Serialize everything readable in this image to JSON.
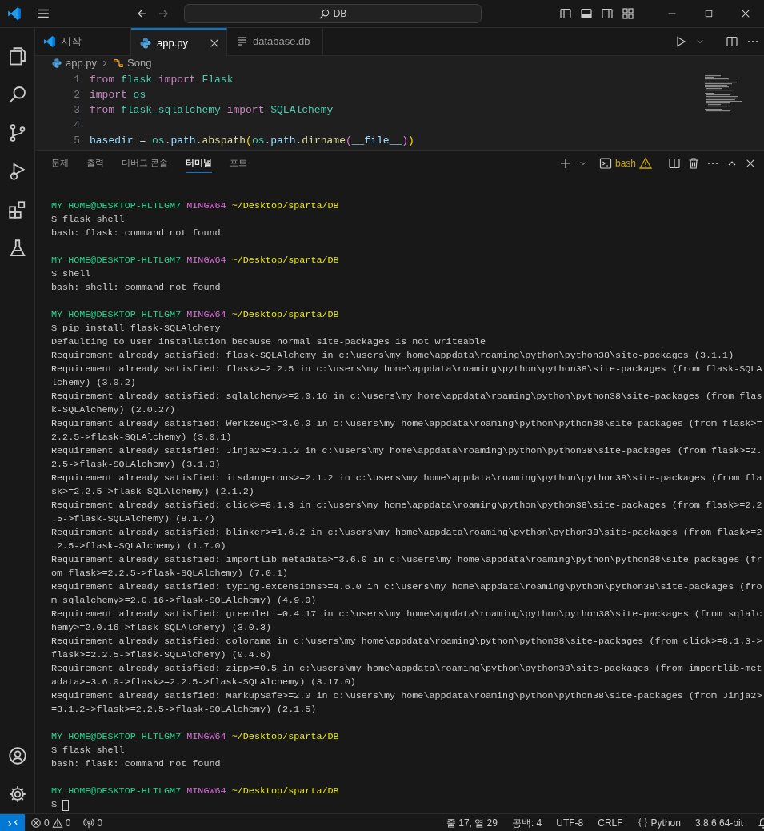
{
  "title_bar": {
    "search": "DB"
  },
  "tabs": [
    {
      "label": "시작",
      "kind": "welcome",
      "selected": false
    },
    {
      "label": "app.py",
      "kind": "python",
      "selected": true
    },
    {
      "label": "database.db",
      "kind": "file",
      "selected": false
    }
  ],
  "breadcrumbs": [
    {
      "label": "app.py",
      "kind": "python"
    },
    {
      "label": "Song",
      "kind": "symbol"
    }
  ],
  "editor": {
    "lines": [
      {
        "number": "1",
        "tokens": [
          {
            "text": "from ",
            "kind": "keyword"
          },
          {
            "text": "flask ",
            "kind": "module"
          },
          {
            "text": "import ",
            "kind": "keyword"
          },
          {
            "text": "Flask",
            "kind": "module"
          }
        ]
      },
      {
        "number": "2",
        "tokens": [
          {
            "text": "import ",
            "kind": "keyword"
          },
          {
            "text": "os",
            "kind": "module"
          }
        ]
      },
      {
        "number": "3",
        "tokens": [
          {
            "text": "from ",
            "kind": "keyword"
          },
          {
            "text": "flask_sqlalchemy ",
            "kind": "module"
          },
          {
            "text": "import ",
            "kind": "keyword"
          },
          {
            "text": "SQLAlchemy",
            "kind": "module"
          }
        ]
      },
      {
        "number": "4"
      },
      {
        "number": "5",
        "tokens": [
          {
            "text": "basedir",
            "kind": "variable"
          },
          {
            "text": " = ",
            "kind": "operator"
          },
          {
            "text": "os",
            "kind": "module"
          },
          {
            "text": ".",
            "kind": "operator"
          },
          {
            "text": "path",
            "kind": "variable"
          },
          {
            "text": ".",
            "kind": "operator"
          },
          {
            "text": "abspath",
            "kind": "function"
          },
          {
            "text": "(",
            "kind": "bracket1"
          },
          {
            "text": "os",
            "kind": "module"
          },
          {
            "text": ".",
            "kind": "operator"
          },
          {
            "text": "path",
            "kind": "variable"
          },
          {
            "text": ".",
            "kind": "operator"
          },
          {
            "text": "dirname",
            "kind": "function"
          },
          {
            "text": "(",
            "kind": "bracket2"
          },
          {
            "text": "__file__",
            "kind": "variable"
          },
          {
            "text": ")",
            "kind": "bracket2"
          },
          {
            "text": ")",
            "kind": "bracket1"
          }
        ]
      }
    ]
  },
  "panel": {
    "tabs": [
      {
        "label": "문제",
        "selected": false
      },
      {
        "label": "출력",
        "selected": false
      },
      {
        "label": "디버그 콘솔",
        "selected": false
      },
      {
        "label": "터미널",
        "selected": true
      },
      {
        "label": "포트",
        "selected": false
      }
    ],
    "terminal_name": "bash",
    "sessions": [
      {
        "user": "MY HOME@DESKTOP-HLTLGM7",
        "system": "MINGW64",
        "path": "~/Desktop/sparta/DB",
        "command": "$ flask shell",
        "cursor": false,
        "output": [
          "bash: flask: command not found"
        ]
      },
      {
        "user": "MY HOME@DESKTOP-HLTLGM7",
        "system": "MINGW64",
        "path": "~/Desktop/sparta/DB",
        "command": "$ shell",
        "cursor": false,
        "output": [
          "bash: shell: command not found"
        ]
      },
      {
        "user": "MY HOME@DESKTOP-HLTLGM7",
        "system": "MINGW64",
        "path": "~/Desktop/sparta/DB",
        "command": "$ pip install flask-SQLAlchemy",
        "cursor": false,
        "output": [
          "Defaulting to user installation because normal site-packages is not writeable",
          "Requirement already satisfied: flask-SQLAlchemy in c:\\users\\my home\\appdata\\roaming\\python\\python38\\site-packages (3.1.1)",
          "Requirement already satisfied: flask>=2.2.5 in c:\\users\\my home\\appdata\\roaming\\python\\python38\\site-packages (from flask-SQLA",
          "lchemy) (3.0.2)",
          "Requirement already satisfied: sqlalchemy>=2.0.16 in c:\\users\\my home\\appdata\\roaming\\python\\python38\\site-packages (from flas",
          "k-SQLAlchemy) (2.0.27)",
          "Requirement already satisfied: Werkzeug>=3.0.0 in c:\\users\\my home\\appdata\\roaming\\python\\python38\\site-packages (from flask>=",
          "2.2.5->flask-SQLAlchemy) (3.0.1)",
          "Requirement already satisfied: Jinja2>=3.1.2 in c:\\users\\my home\\appdata\\roaming\\python\\python38\\site-packages (from flask>=2.",
          "2.5->flask-SQLAlchemy) (3.1.3)",
          "Requirement already satisfied: itsdangerous>=2.1.2 in c:\\users\\my home\\appdata\\roaming\\python\\python38\\site-packages (from fla",
          "sk>=2.2.5->flask-SQLAlchemy) (2.1.2)",
          "Requirement already satisfied: click>=8.1.3 in c:\\users\\my home\\appdata\\roaming\\python\\python38\\site-packages (from flask>=2.2",
          ".5->flask-SQLAlchemy) (8.1.7)",
          "Requirement already satisfied: blinker>=1.6.2 in c:\\users\\my home\\appdata\\roaming\\python\\python38\\site-packages (from flask>=2",
          ".2.5->flask-SQLAlchemy) (1.7.0)",
          "Requirement already satisfied: importlib-metadata>=3.6.0 in c:\\users\\my home\\appdata\\roaming\\python\\python38\\site-packages (fr",
          "om flask>=2.2.5->flask-SQLAlchemy) (7.0.1)",
          "Requirement already satisfied: typing-extensions>=4.6.0 in c:\\users\\my home\\appdata\\roaming\\python\\python38\\site-packages (fro",
          "m sqlalchemy>=2.0.16->flask-SQLAlchemy) (4.9.0)",
          "Requirement already satisfied: greenlet!=0.4.17 in c:\\users\\my home\\appdata\\roaming\\python\\python38\\site-packages (from sqlalc",
          "hemy>=2.0.16->flask-SQLAlchemy) (3.0.3)",
          "Requirement already satisfied: colorama in c:\\users\\my home\\appdata\\roaming\\python\\python38\\site-packages (from click>=8.1.3->",
          "flask>=2.2.5->flask-SQLAlchemy) (0.4.6)",
          "Requirement already satisfied: zipp>=0.5 in c:\\users\\my home\\appdata\\roaming\\python\\python38\\site-packages (from importlib-met",
          "adata>=3.6.0->flask>=2.2.5->flask-SQLAlchemy) (3.17.0)",
          "Requirement already satisfied: MarkupSafe>=2.0 in c:\\users\\my home\\appdata\\roaming\\python\\python38\\site-packages (from Jinja2>",
          "=3.1.2->flask>=2.2.5->flask-SQLAlchemy) (2.1.5)"
        ]
      },
      {
        "user": "MY HOME@DESKTOP-HLTLGM7",
        "system": "MINGW64",
        "path": "~/Desktop/sparta/DB",
        "command": "$ flask shell",
        "cursor": false,
        "output": [
          "bash: flask: command not found"
        ]
      },
      {
        "user": "MY HOME@DESKTOP-HLTLGM7",
        "system": "MINGW64",
        "path": "~/Desktop/sparta/DB",
        "command": "$",
        "cursor": true
      }
    ]
  },
  "status_bar": {
    "errors": "0",
    "warnings": "0",
    "ports": "0",
    "position": "줄 17, 열 29",
    "indent": "공백: 4",
    "encoding": "UTF-8",
    "eol": "CRLF",
    "language": "Python",
    "interpreter": "3.8.6 64-bit"
  }
}
